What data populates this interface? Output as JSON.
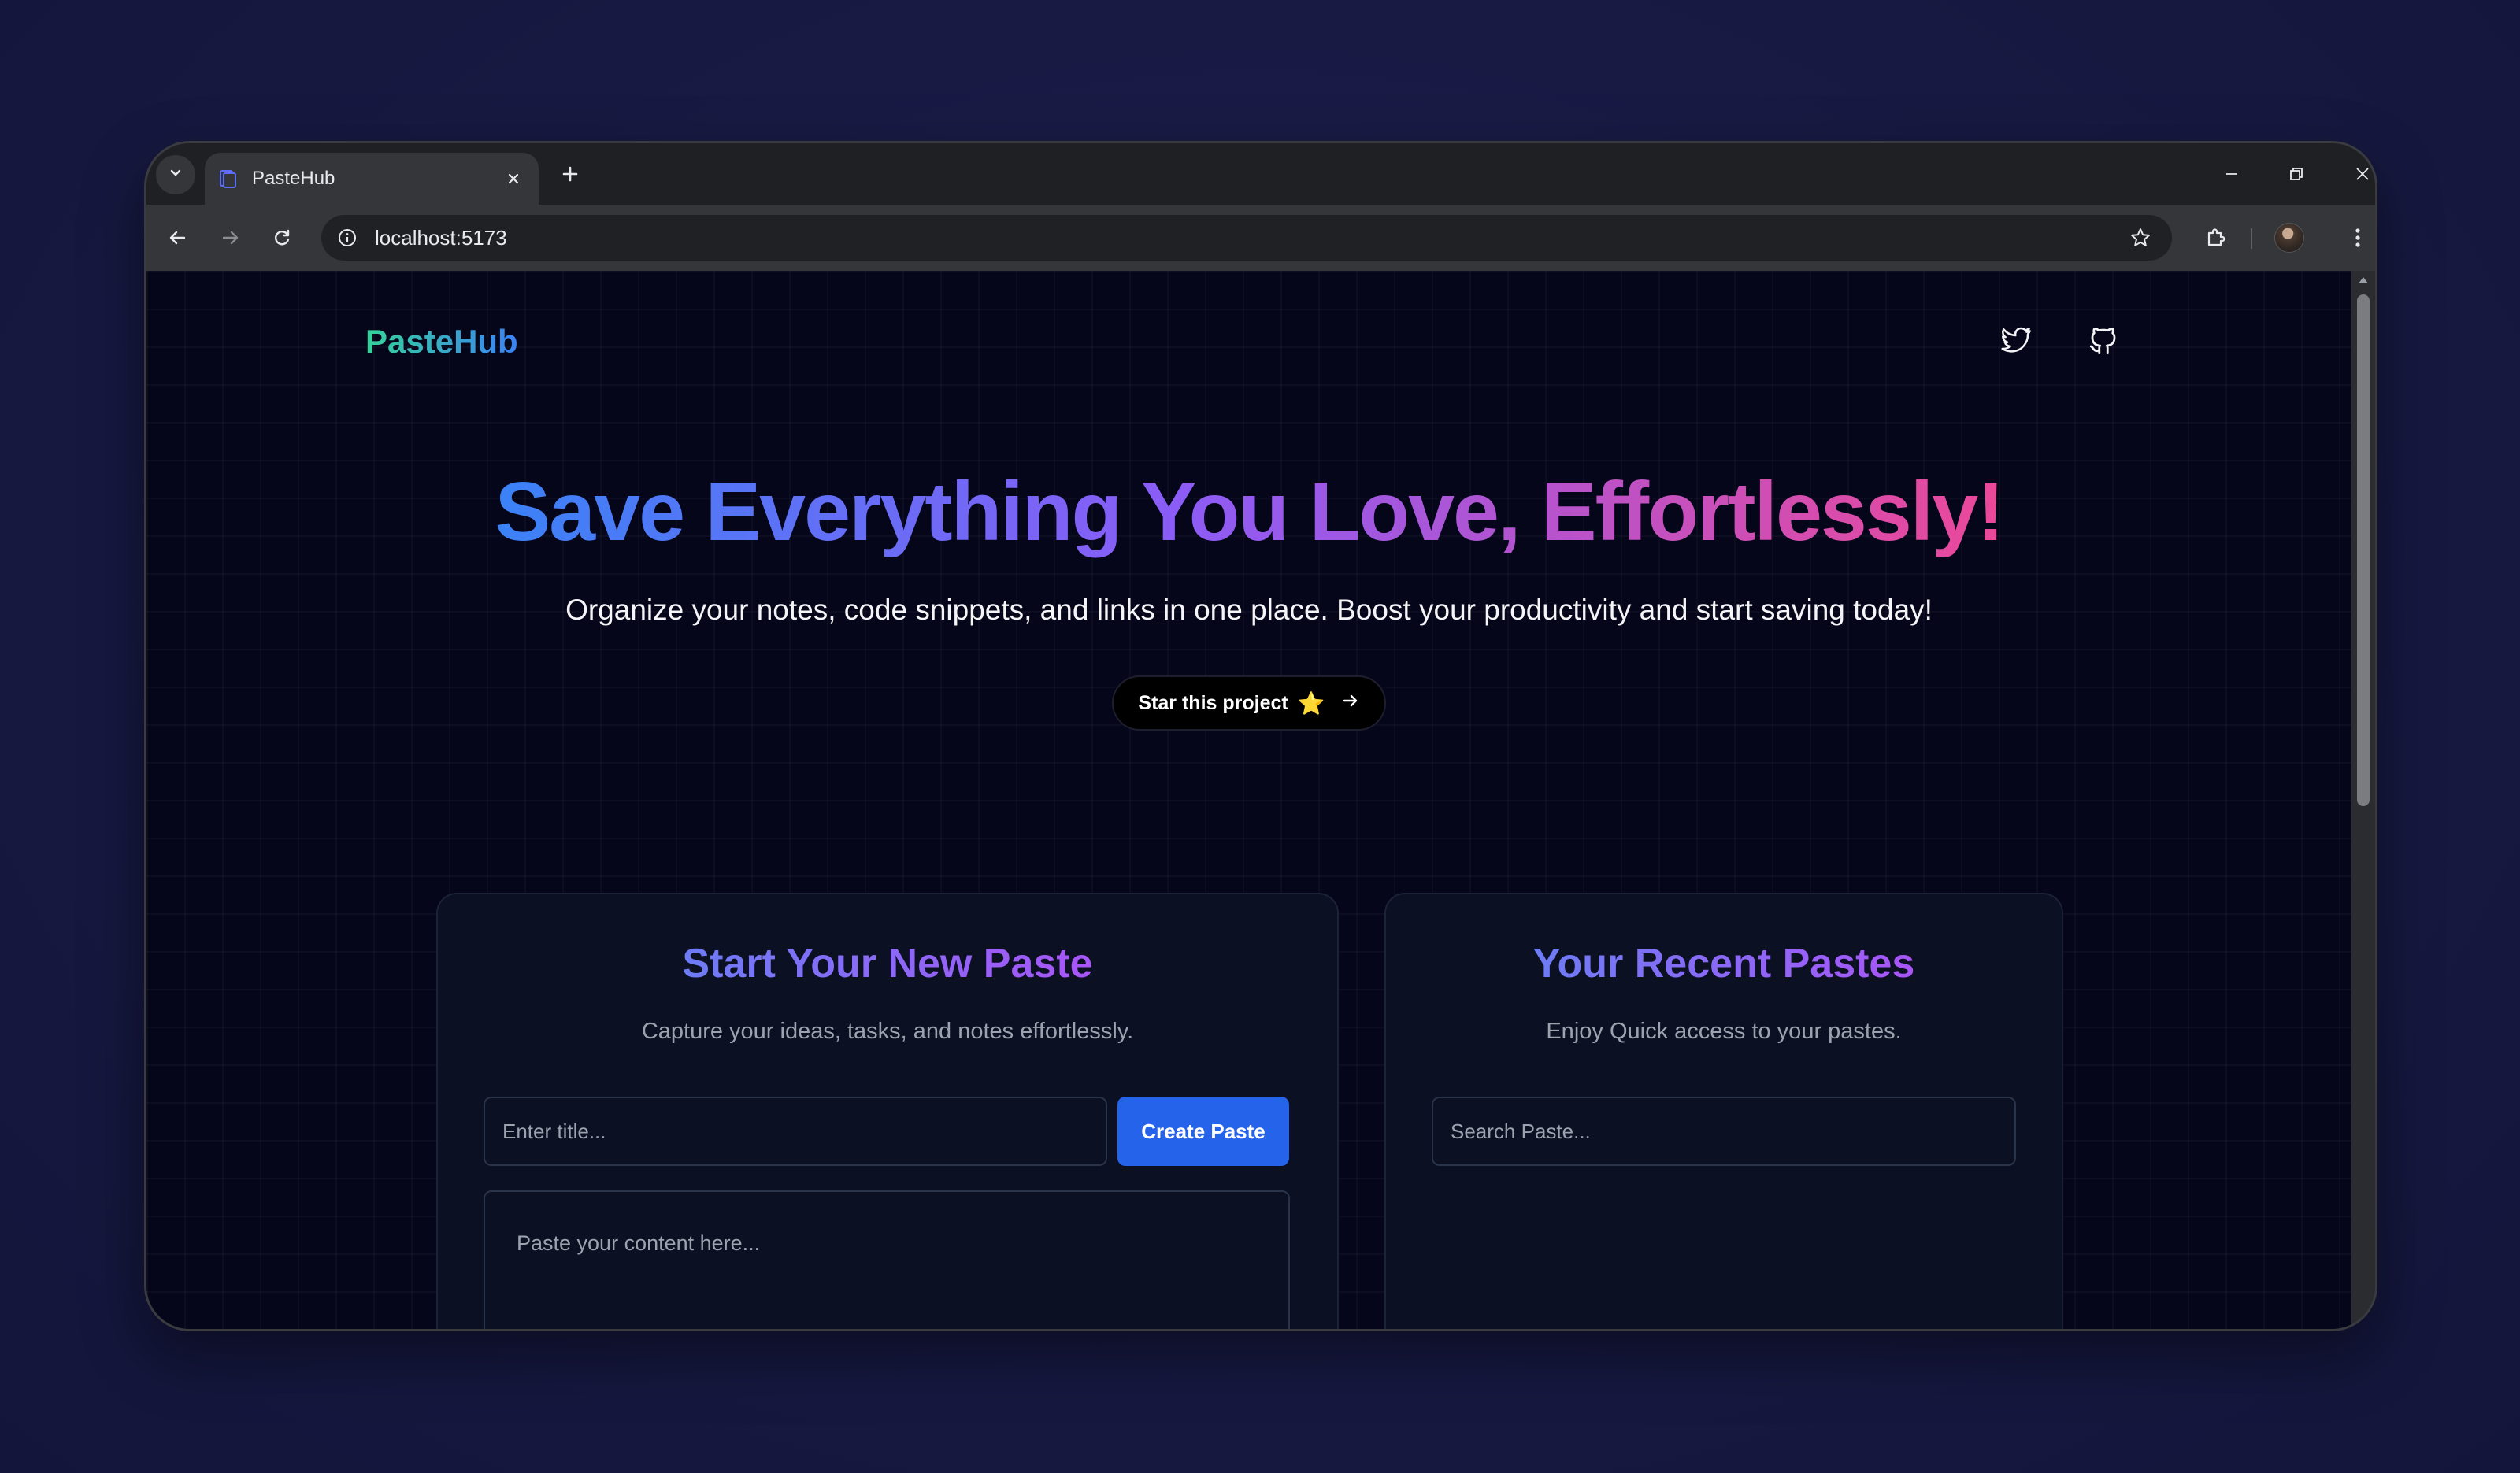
{
  "browser": {
    "tab_title": "PasteHub",
    "url": "localhost:5173"
  },
  "page": {
    "logo": "PasteHub",
    "hero_title": "Save Everything You Love, Effortlessly!",
    "hero_subtitle": "Organize your notes, code snippets, and links in one place. Boost your productivity and start saving today!",
    "star_button_label": "Star this project",
    "star_emoji": "⭐"
  },
  "new_paste": {
    "title": "Start Your New Paste",
    "subtitle": "Capture your ideas, tasks, and notes effortlessly.",
    "title_placeholder": "Enter title...",
    "create_label": "Create Paste",
    "content_placeholder": "Paste your content here..."
  },
  "recent": {
    "title": "Your Recent Pastes",
    "subtitle": "Enjoy Quick access to your pastes.",
    "search_placeholder": "Search Paste..."
  },
  "colors": {
    "accent": "#2563eb",
    "background": "#05061a",
    "gradient_start": "#3b82f6",
    "gradient_mid": "#8b5cf6",
    "gradient_end": "#ec4899"
  }
}
